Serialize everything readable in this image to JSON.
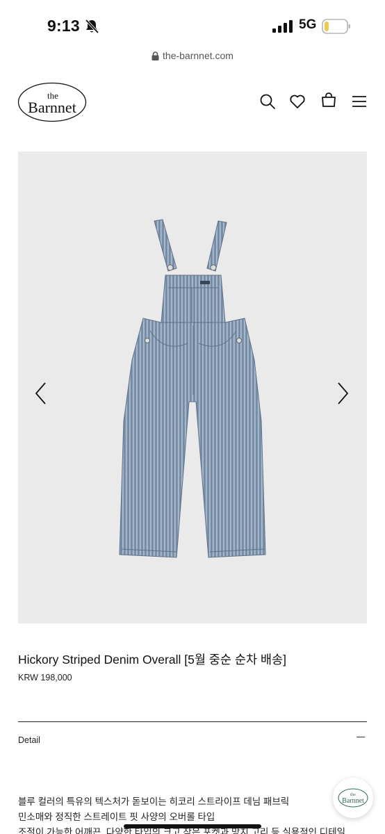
{
  "status_bar": {
    "time": "9:13",
    "network": "5G",
    "battery_level": 0.2,
    "battery_color": "#f2c94c",
    "icons": [
      "bell-slash-icon",
      "signal-icon",
      "battery-icon"
    ]
  },
  "browser": {
    "url": "the-barnnet.com",
    "lock_icon": "lock-icon"
  },
  "header": {
    "logo_small": "the",
    "logo_main": "Barnnet",
    "icons": [
      "search-icon",
      "heart-icon",
      "bag-icon",
      "menu-icon"
    ]
  },
  "product": {
    "image_icon": "overall-image",
    "prev_icon": "chevron-left-icon",
    "next_icon": "chevron-right-icon",
    "title": "Hickory Striped Denim Overall [5월 중순 순차 배송]",
    "price": "KRW 198,000",
    "detail_label": "Detail",
    "detail_toggle_icon": "minus-icon",
    "description": [
      "블루 컬러의 특유의 텍스처가 돋보이는 히코리 스트라이프 데님 패브릭",
      "민소매와 정직한 스트레이트 핏 사양의 오버롤 타입",
      "조절이 가능한 어깨끈, 다양한 타입의 크고 작은 포켓과 망치 고리 등 실용적인 디테일"
    ]
  },
  "chat_button": {
    "logo_small": "the",
    "logo_main": "Barnnet",
    "accent": "#2f6b4f"
  },
  "colors": {
    "text": "#111111",
    "background": "#ffffff",
    "image_background": "#eaeaea",
    "denim": "#7d93ad"
  }
}
